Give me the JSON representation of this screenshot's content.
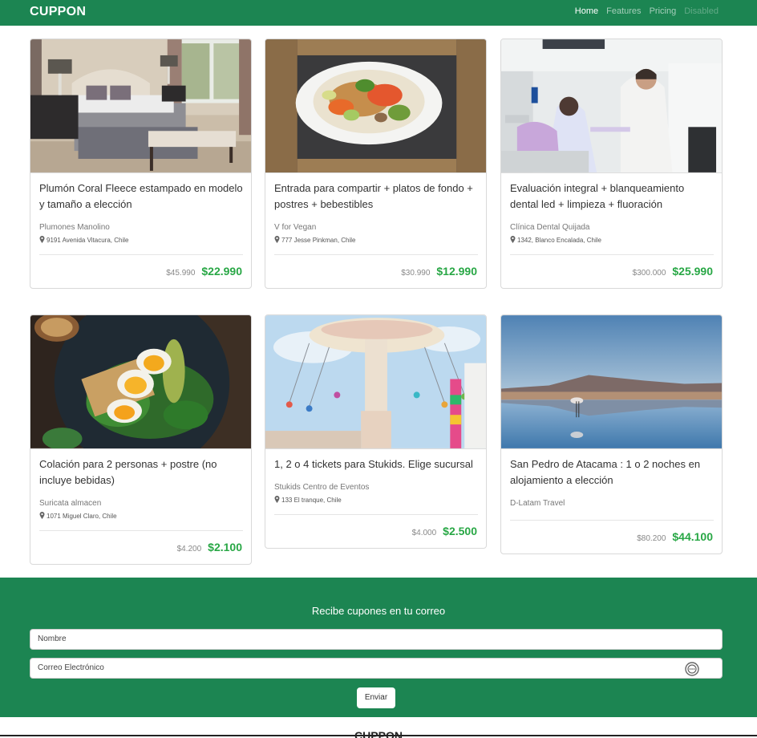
{
  "navbar": {
    "brand": "CUPPON",
    "links": [
      {
        "label": "Home",
        "state": "active"
      },
      {
        "label": "Features",
        "state": "normal"
      },
      {
        "label": "Pricing",
        "state": "normal"
      },
      {
        "label": "Disabled",
        "state": "disabled"
      }
    ]
  },
  "deals": [
    {
      "title": "Plumón Coral Fleece estampado en modelo y tamaño a elección",
      "merchant": "Plumones Manolino",
      "address": "9191 Avenida Vitacura, Chile",
      "old_price": "$45.990",
      "price": "$22.990"
    },
    {
      "title": "Entrada para compartir + platos de fondo + postres + bebestibles",
      "merchant": "V for Vegan",
      "address": "777 Jesse Pinkman, Chile",
      "old_price": "$30.990",
      "price": "$12.990"
    },
    {
      "title": "Evaluación integral + blanqueamiento dental led + limpieza + fluoración",
      "merchant": "Clínica Dental Quijada",
      "address": "1342, Blanco Encalada, Chile",
      "old_price": "$300.000",
      "price": "$25.990"
    },
    {
      "title": "Colación para 2 personas + postre (no incluye bebidas)",
      "merchant": "Suricata almacen",
      "address": "1071 Miguel Claro, Chile",
      "old_price": "$4.200",
      "price": "$2.100"
    },
    {
      "title": "1, 2 o 4 tickets para Stukids. Elige sucursal",
      "merchant": "Stukids Centro de Eventos",
      "address": "133 El tranque, Chile",
      "old_price": "$4.000",
      "price": "$2.500"
    },
    {
      "title": "San Pedro de Atacama : 1 o 2 noches en alojamiento a elección",
      "merchant": "D-Latam Travel",
      "address": "",
      "old_price": "$80.200",
      "price": "$44.100"
    }
  ],
  "newsletter": {
    "title": "Recibe cupones en tu correo",
    "name_placeholder": "Nombre",
    "email_placeholder": "Correo Electrónico",
    "submit_label": "Enviar"
  },
  "footer": {
    "brand": "CUPPON"
  },
  "colors": {
    "brand_green": "#1c8552",
    "price_green": "#28a745"
  }
}
